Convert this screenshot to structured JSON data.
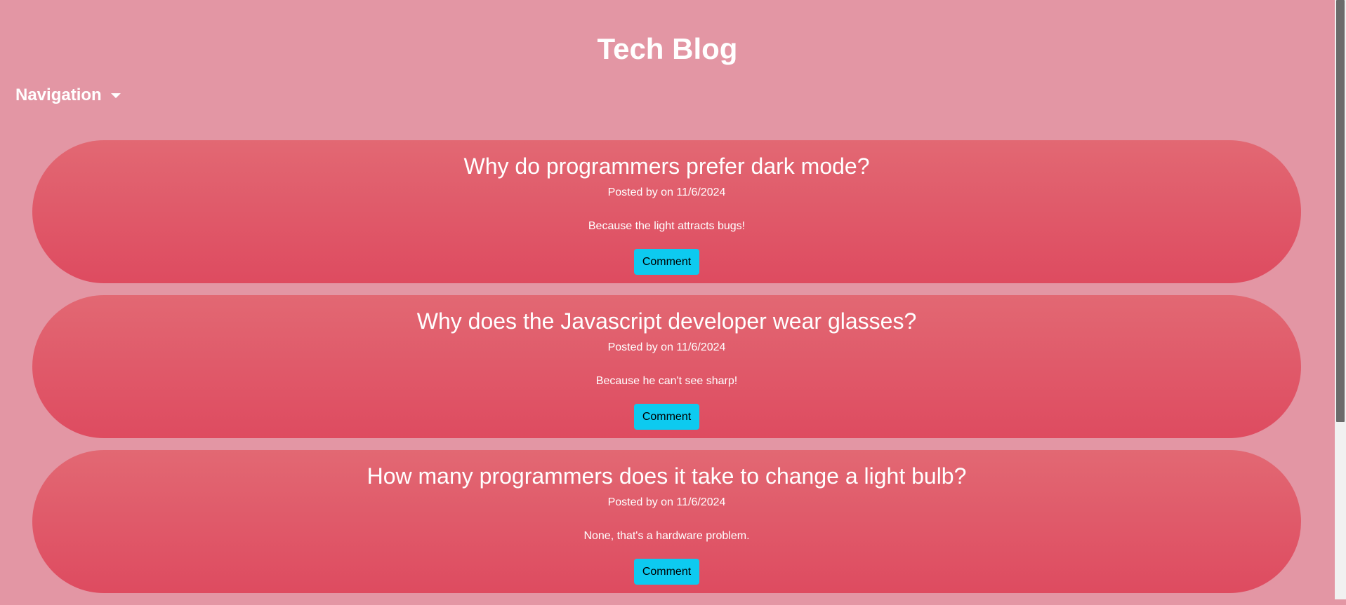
{
  "header": {
    "title": "Tech Blog"
  },
  "nav": {
    "label": "Navigation",
    "icon": "caret-down-icon"
  },
  "posts": [
    {
      "title": "Why do programmers prefer dark mode?",
      "meta": "Posted by on 11/6/2024",
      "body": "Because the light attracts bugs!",
      "button": "Comment"
    },
    {
      "title": "Why does the Javascript developer wear glasses?",
      "meta": "Posted by on 11/6/2024",
      "body": "Because he can't see sharp!",
      "button": "Comment"
    },
    {
      "title": "How many programmers does it take to change a light bulb?",
      "meta": "Posted by on 11/6/2024",
      "body": "None, that's a hardware problem.",
      "button": "Comment"
    }
  ],
  "colors": {
    "background": "#e396a4",
    "card_top": "#e26873",
    "card_bottom": "#de4b60",
    "button": "#0dcaf0",
    "text": "#ffffff"
  }
}
